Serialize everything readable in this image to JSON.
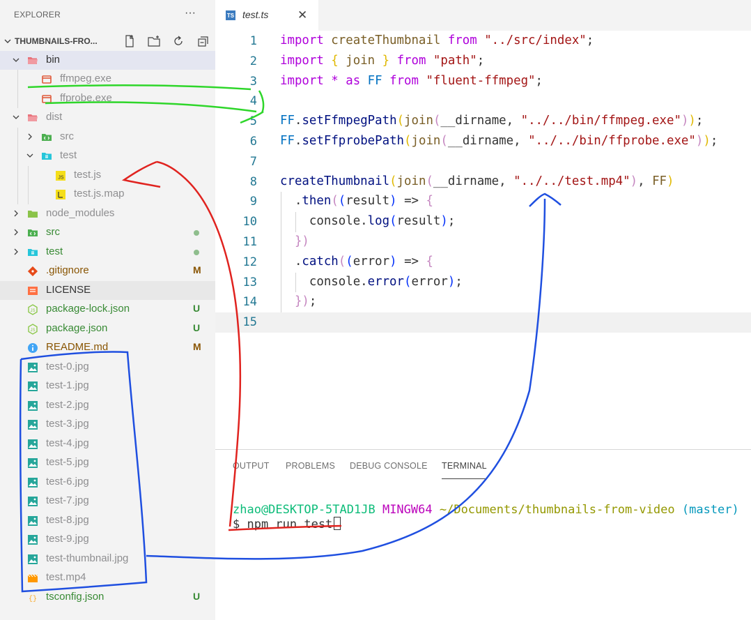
{
  "sidebar": {
    "title": "EXPLORER",
    "more_label": "···",
    "folder_title": "THUMBNAILS-FRO...",
    "actions": [
      "new-file-icon",
      "new-folder-icon",
      "refresh-icon",
      "collapse-all-icon"
    ],
    "items": [
      {
        "label": "bin",
        "icon": "folder-open-icon",
        "kind": "folder"
      },
      {
        "label": "ffmpeg.exe",
        "icon": "exe-icon",
        "kind": "file"
      },
      {
        "label": "ffprobe.exe",
        "icon": "exe-icon",
        "kind": "file"
      },
      {
        "label": "dist",
        "icon": "folder-open-icon",
        "kind": "folder"
      },
      {
        "label": "src",
        "icon": "src-folder-icon",
        "kind": "folder"
      },
      {
        "label": "test",
        "icon": "test-folder-icon",
        "kind": "folder"
      },
      {
        "label": "test.js",
        "icon": "js-icon",
        "kind": "file"
      },
      {
        "label": "test.js.map",
        "icon": "js-map-icon",
        "kind": "file"
      },
      {
        "label": "node_modules",
        "icon": "node-folder-icon",
        "kind": "folder"
      },
      {
        "label": "src",
        "icon": "src-folder-icon",
        "kind": "folder"
      },
      {
        "label": "test",
        "icon": "test-folder-icon",
        "kind": "folder"
      },
      {
        "label": ".gitignore",
        "icon": "git-icon",
        "badge": "M"
      },
      {
        "label": "LICENSE",
        "icon": "license-icon"
      },
      {
        "label": "package-lock.json",
        "icon": "nodejs-icon",
        "badge": "U"
      },
      {
        "label": "package.json",
        "icon": "nodejs-icon",
        "badge": "U"
      },
      {
        "label": "README.md",
        "icon": "info-icon",
        "badge": "M"
      },
      {
        "label": "test-0.jpg",
        "icon": "image-icon"
      },
      {
        "label": "test-1.jpg",
        "icon": "image-icon"
      },
      {
        "label": "test-2.jpg",
        "icon": "image-icon"
      },
      {
        "label": "test-3.jpg",
        "icon": "image-icon"
      },
      {
        "label": "test-4.jpg",
        "icon": "image-icon"
      },
      {
        "label": "test-5.jpg",
        "icon": "image-icon"
      },
      {
        "label": "test-6.jpg",
        "icon": "image-icon"
      },
      {
        "label": "test-7.jpg",
        "icon": "image-icon"
      },
      {
        "label": "test-8.jpg",
        "icon": "image-icon"
      },
      {
        "label": "test-9.jpg",
        "icon": "image-icon"
      },
      {
        "label": "test-thumbnail.jpg",
        "icon": "image-icon"
      },
      {
        "label": "test.mp4",
        "icon": "video-icon"
      },
      {
        "label": "tsconfig.json",
        "icon": "json-icon",
        "badge": "U"
      }
    ]
  },
  "tab": {
    "label": "test.ts",
    "icon_text": "TS"
  },
  "editor": {
    "lines": [
      {
        "n": "1",
        "tokens": [
          [
            "kw",
            "import "
          ],
          [
            "id",
            "createThumbnail "
          ],
          [
            "kw",
            "from "
          ],
          [
            "str",
            "\"../src/index\""
          ],
          [
            "plain",
            ";"
          ]
        ]
      },
      {
        "n": "2",
        "tokens": [
          [
            "kw",
            "import "
          ],
          [
            "yel",
            "{ "
          ],
          [
            "id",
            "join "
          ],
          [
            "yel",
            "} "
          ],
          [
            "kw",
            "from "
          ],
          [
            "str",
            "\"path\""
          ],
          [
            "plain",
            ";"
          ]
        ]
      },
      {
        "n": "3",
        "tokens": [
          [
            "kw",
            "import "
          ],
          [
            "op",
            "* "
          ],
          [
            "kw",
            "as "
          ],
          [
            "ffvar",
            "FF "
          ],
          [
            "kw",
            "from "
          ],
          [
            "str",
            "\"fluent-ffmpeg\""
          ],
          [
            "plain",
            ";"
          ]
        ]
      },
      {
        "n": "4",
        "tokens": []
      },
      {
        "n": "5",
        "tokens": [
          [
            "ffvar",
            "FF"
          ],
          [
            "plain",
            "."
          ],
          [
            "var",
            "setFfmpegPath"
          ],
          [
            "yel",
            "("
          ],
          [
            "fn",
            "join"
          ],
          [
            "brace",
            "("
          ],
          [
            "plain",
            "__dirname, "
          ],
          [
            "str",
            "\"../../bin/ffmpeg.exe\""
          ],
          [
            "brace",
            ")"
          ],
          [
            "yel",
            ")"
          ],
          [
            "plain",
            ";"
          ]
        ]
      },
      {
        "n": "6",
        "tokens": [
          [
            "ffvar",
            "FF"
          ],
          [
            "plain",
            "."
          ],
          [
            "var",
            "setFfprobePath"
          ],
          [
            "yel",
            "("
          ],
          [
            "fn",
            "join"
          ],
          [
            "brace",
            "("
          ],
          [
            "plain",
            "__dirname, "
          ],
          [
            "str",
            "\"../../bin/ffprobe.exe\""
          ],
          [
            "brace",
            ")"
          ],
          [
            "yel",
            ")"
          ],
          [
            "plain",
            ";"
          ]
        ]
      },
      {
        "n": "7",
        "tokens": []
      },
      {
        "n": "8",
        "tokens": [
          [
            "var",
            "createThumbnail"
          ],
          [
            "yel",
            "("
          ],
          [
            "fn",
            "join"
          ],
          [
            "brace",
            "("
          ],
          [
            "plain",
            "__dirname, "
          ],
          [
            "str",
            "\"../../test.mp4\""
          ],
          [
            "brace",
            ")"
          ],
          [
            "plain",
            ", "
          ],
          [
            "id",
            "FF"
          ],
          [
            "yel",
            ")"
          ]
        ]
      },
      {
        "n": "9",
        "tokens": [
          [
            "plain",
            "  ."
          ],
          [
            "var",
            "then"
          ],
          [
            "brace",
            "("
          ],
          [
            "b1",
            "("
          ],
          [
            "plain",
            "result"
          ],
          [
            "b1",
            ")"
          ],
          [
            "plain",
            " => "
          ],
          [
            "brace",
            "{"
          ]
        ]
      },
      {
        "n": "10",
        "tokens": [
          [
            "plain",
            "    console."
          ],
          [
            "var",
            "log"
          ],
          [
            "b1",
            "("
          ],
          [
            "plain",
            "result"
          ],
          [
            "b1",
            ")"
          ],
          [
            "plain",
            ";"
          ]
        ]
      },
      {
        "n": "11",
        "tokens": [
          [
            "plain",
            "  "
          ],
          [
            "brace",
            "})"
          ]
        ]
      },
      {
        "n": "12",
        "tokens": [
          [
            "plain",
            "  ."
          ],
          [
            "var",
            "catch"
          ],
          [
            "brace",
            "("
          ],
          [
            "b1",
            "("
          ],
          [
            "plain",
            "error"
          ],
          [
            "b1",
            ")"
          ],
          [
            "plain",
            " => "
          ],
          [
            "brace",
            "{"
          ]
        ]
      },
      {
        "n": "13",
        "tokens": [
          [
            "plain",
            "    console."
          ],
          [
            "var",
            "error"
          ],
          [
            "b1",
            "("
          ],
          [
            "plain",
            "error"
          ],
          [
            "b1",
            ")"
          ],
          [
            "plain",
            ";"
          ]
        ]
      },
      {
        "n": "14",
        "tokens": [
          [
            "plain",
            "  "
          ],
          [
            "brace",
            "})"
          ],
          [
            "plain",
            ";"
          ]
        ]
      },
      {
        "n": "15",
        "tokens": []
      }
    ]
  },
  "panel": {
    "tabs": [
      "OUTPUT",
      "PROBLEMS",
      "DEBUG CONSOLE",
      "TERMINAL"
    ],
    "active_tab": "TERMINAL",
    "terminal": {
      "user_host": "zhao@DESKTOP-5TAD1JB",
      "shell": "MINGW64",
      "path": "~/Documents/thumbnails-from-video",
      "branch": "(master)",
      "prompt": "$ npm run test"
    }
  },
  "colors": {
    "annotation_green": "#2ed62a",
    "annotation_red": "#e0231f",
    "annotation_blue": "#1f4fe0"
  }
}
